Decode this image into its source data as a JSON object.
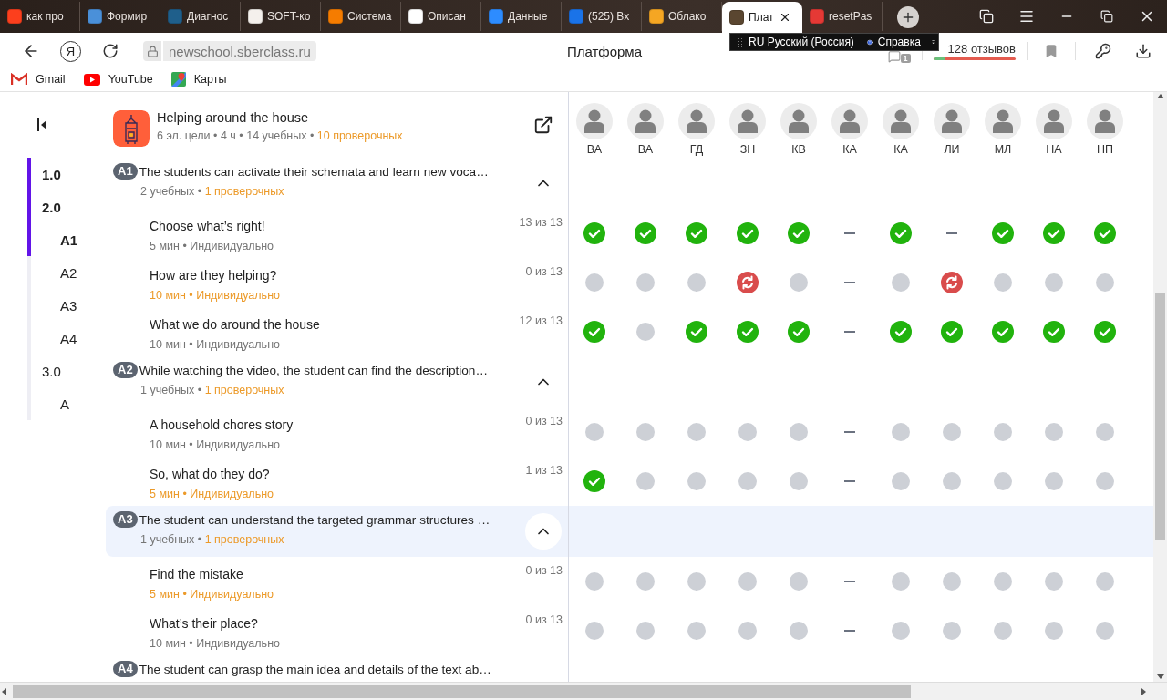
{
  "browser": {
    "tabs": [
      {
        "label": "как про",
        "color": "#fc3f1d",
        "selected": false
      },
      {
        "label": "Формир",
        "color": "#4a90d9",
        "selected": false
      },
      {
        "label": "Диагнос",
        "color": "#1f5f8b",
        "selected": false
      },
      {
        "label": "SOFT-ко",
        "color": "#f4f0ec",
        "selected": false
      },
      {
        "label": "Система",
        "color": "#f57c00",
        "selected": false
      },
      {
        "label": "Описан",
        "color": "#ffffff",
        "selected": false
      },
      {
        "label": "Данные",
        "color": "#2d8cff",
        "selected": false
      },
      {
        "label": "(525) Вх",
        "color": "#1a73e8",
        "selected": false
      },
      {
        "label": "Облако",
        "color": "#f5a623",
        "selected": false
      },
      {
        "label": "Плат",
        "color": "#5a4630",
        "selected": true
      },
      {
        "label": "resetPas",
        "color": "#e53935",
        "selected": false
      }
    ],
    "logo": "Я",
    "address": "newschool.sberclass.ru",
    "page_title": "Платформа",
    "reviews": {
      "badge": "1",
      "text": "128 отзывов",
      "level": 0.15
    },
    "bookmarks": [
      {
        "label": "Gmail",
        "kind": "gmail"
      },
      {
        "label": "YouTube",
        "kind": "youtube"
      },
      {
        "label": "Карты",
        "kind": "maps"
      }
    ],
    "language_bar": {
      "language": "RU Русский (Россия)",
      "help": "Справка"
    }
  },
  "nav": {
    "items": [
      {
        "label": "1.0",
        "bold": true,
        "highlighted": true
      },
      {
        "label": "2.0",
        "bold": true,
        "highlighted": true,
        "children": [
          {
            "label": "A1",
            "bold": true,
            "highlighted": true
          },
          {
            "label": "A2",
            "bold": false,
            "highlighted": false
          },
          {
            "label": "A3",
            "bold": false,
            "highlighted": false
          },
          {
            "label": "A4",
            "bold": false,
            "highlighted": false
          }
        ]
      },
      {
        "label": "3.0",
        "bold": false,
        "highlighted": false,
        "children": [
          {
            "label": "A",
            "bold": false,
            "highlighted": false
          }
        ]
      }
    ]
  },
  "course": {
    "title": "Helping around the house",
    "meta": "6 эл. цели • 4 ч • 14 учебных • ",
    "meta_accent": "10 проверочных"
  },
  "students": [
    {
      "initials": "ВА"
    },
    {
      "initials": "ВА"
    },
    {
      "initials": "ГД"
    },
    {
      "initials": "ЗН"
    },
    {
      "initials": "КВ"
    },
    {
      "initials": "КА"
    },
    {
      "initials": "КА"
    },
    {
      "initials": "ЛИ"
    },
    {
      "initials": "МЛ"
    },
    {
      "initials": "НА"
    },
    {
      "initials": "НП"
    }
  ],
  "goals": [
    {
      "code": "A1",
      "title": "The students can activate their schemata and learn new voca…",
      "meta": "2 учебных • ",
      "meta_accent": "1 проверочных",
      "expanded": true,
      "highlighted": false,
      "lessons": [
        {
          "title": "Choose what’s right!",
          "count": "13 из 13",
          "meta": "5 мин • Индивидуально",
          "accent": false,
          "statuses": [
            {
              "kind": "done"
            },
            {
              "kind": "done"
            },
            {
              "kind": "done"
            },
            {
              "kind": "done"
            },
            {
              "kind": "done"
            },
            {
              "kind": "none"
            },
            {
              "kind": "done"
            },
            {
              "kind": "none"
            },
            {
              "kind": "done"
            },
            {
              "kind": "done"
            },
            {
              "kind": "done"
            }
          ]
        },
        {
          "title": "How are they helping?",
          "count": "0 из 13",
          "meta": "10 мин • Индивидуально",
          "accent": true,
          "statuses": [
            {
              "kind": "pending"
            },
            {
              "kind": "pending"
            },
            {
              "kind": "pending"
            },
            {
              "kind": "retry"
            },
            {
              "kind": "pending"
            },
            {
              "kind": "none"
            },
            {
              "kind": "pending"
            },
            {
              "kind": "retry"
            },
            {
              "kind": "pending"
            },
            {
              "kind": "pending"
            },
            {
              "kind": "pending"
            }
          ]
        },
        {
          "title": "What we do around the house",
          "count": "12 из 13",
          "meta": "10 мин • Индивидуально",
          "accent": false,
          "statuses": [
            {
              "kind": "done"
            },
            {
              "kind": "pending"
            },
            {
              "kind": "done"
            },
            {
              "kind": "done"
            },
            {
              "kind": "done"
            },
            {
              "kind": "none"
            },
            {
              "kind": "done"
            },
            {
              "kind": "done"
            },
            {
              "kind": "done"
            },
            {
              "kind": "done"
            },
            {
              "kind": "done"
            }
          ]
        }
      ]
    },
    {
      "code": "A2",
      "title": "While watching the video, the student can find the description…",
      "meta": "1 учебных • ",
      "meta_accent": "1 проверочных",
      "expanded": true,
      "highlighted": false,
      "lessons": [
        {
          "title": "A household chores story",
          "count": "0 из 13",
          "meta": "10 мин • Индивидуально",
          "accent": false,
          "statuses": [
            {
              "kind": "pending"
            },
            {
              "kind": "pending"
            },
            {
              "kind": "pending"
            },
            {
              "kind": "pending"
            },
            {
              "kind": "pending"
            },
            {
              "kind": "none"
            },
            {
              "kind": "pending"
            },
            {
              "kind": "pending"
            },
            {
              "kind": "pending"
            },
            {
              "kind": "pending"
            },
            {
              "kind": "pending"
            }
          ]
        },
        {
          "title": "So, what do they do?",
          "count": "1 из 13",
          "meta": "5 мин • Индивидуально",
          "accent": true,
          "statuses": [
            {
              "kind": "done"
            },
            {
              "kind": "pending"
            },
            {
              "kind": "pending"
            },
            {
              "kind": "pending"
            },
            {
              "kind": "pending"
            },
            {
              "kind": "none"
            },
            {
              "kind": "pending"
            },
            {
              "kind": "pending"
            },
            {
              "kind": "pending"
            },
            {
              "kind": "pending"
            },
            {
              "kind": "pending"
            }
          ]
        }
      ]
    },
    {
      "code": "A3",
      "title": "The student can understand the targeted grammar structures …",
      "meta": "1 учебных • ",
      "meta_accent": "1 проверочных",
      "expanded": true,
      "highlighted": true,
      "lessons": [
        {
          "title": "Find the mistake",
          "count": "0 из 13",
          "meta": "5 мин • Индивидуально",
          "accent": true,
          "statuses": [
            {
              "kind": "pending"
            },
            {
              "kind": "pending"
            },
            {
              "kind": "pending"
            },
            {
              "kind": "pending"
            },
            {
              "kind": "pending"
            },
            {
              "kind": "none"
            },
            {
              "kind": "pending"
            },
            {
              "kind": "pending"
            },
            {
              "kind": "pending"
            },
            {
              "kind": "pending"
            },
            {
              "kind": "pending"
            }
          ]
        },
        {
          "title": "What’s their place?",
          "count": "0 из 13",
          "meta": "10 мин • Индивидуально",
          "accent": false,
          "statuses": [
            {
              "kind": "pending"
            },
            {
              "kind": "pending"
            },
            {
              "kind": "pending"
            },
            {
              "kind": "pending"
            },
            {
              "kind": "pending"
            },
            {
              "kind": "none"
            },
            {
              "kind": "pending"
            },
            {
              "kind": "pending"
            },
            {
              "kind": "pending"
            },
            {
              "kind": "pending"
            },
            {
              "kind": "pending"
            }
          ]
        }
      ]
    },
    {
      "code": "A4",
      "title": "The student can grasp the main idea and details of the text ab…",
      "highlighted": false
    }
  ]
}
